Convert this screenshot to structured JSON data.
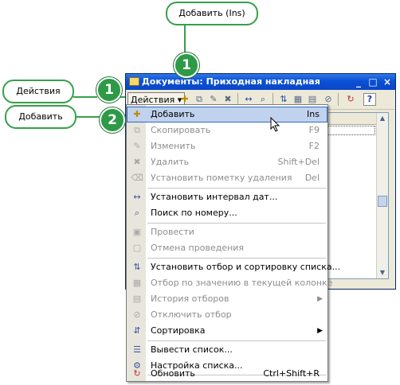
{
  "window": {
    "title": "Документы: Приходная накладная",
    "minimize_glyph": "_",
    "maximize_glyph": "□",
    "close_glyph": "×"
  },
  "toolbar": {
    "actions_label": "Действия ▾"
  },
  "callouts": {
    "add_ins": "Добавить (Ins)",
    "actions": "Действия",
    "add": "Добавить",
    "badge_top": "1",
    "badge_actions": "1",
    "badge_add": "2"
  },
  "menu": {
    "items": [
      {
        "label": "Добавить",
        "shortcut": "Ins",
        "disabled": false,
        "icon": "add-icon"
      },
      {
        "label": "Скопировать",
        "shortcut": "F9",
        "disabled": true,
        "icon": "copy-icon"
      },
      {
        "label": "Изменить",
        "shortcut": "F2",
        "disabled": true,
        "icon": "edit-icon"
      },
      {
        "label": "Удалить",
        "shortcut": "Shift+Del",
        "disabled": true,
        "icon": "delete-icon"
      },
      {
        "label": "Установить пометку удаления",
        "shortcut": "Del",
        "disabled": true,
        "icon": "mark-delete-icon"
      },
      {
        "label": "Установить интервал дат...",
        "shortcut": "",
        "disabled": false,
        "icon": "date-interval-icon"
      },
      {
        "label": "Поиск по номеру...",
        "shortcut": "",
        "disabled": false,
        "icon": "search-number-icon"
      },
      {
        "label": "Провести",
        "shortcut": "",
        "disabled": true,
        "icon": "post-icon"
      },
      {
        "label": "Отмена проведения",
        "shortcut": "",
        "disabled": true,
        "icon": "unpost-icon"
      },
      {
        "label": "Установить отбор и сортировку списка...",
        "shortcut": "",
        "disabled": false,
        "icon": "filter-sort-icon"
      },
      {
        "label": "Отбор по значению в текущей колонке",
        "shortcut": "",
        "disabled": true,
        "icon": "filter-value-icon"
      },
      {
        "label": "История отборов",
        "shortcut": "",
        "disabled": true,
        "icon": "filter-history-icon"
      },
      {
        "label": "Отключить отбор",
        "shortcut": "",
        "disabled": true,
        "icon": "filter-off-icon"
      },
      {
        "label": "Сортировка",
        "shortcut": "",
        "disabled": false,
        "icon": "sort-icon"
      },
      {
        "label": "Вывести список...",
        "shortcut": "",
        "disabled": false,
        "icon": "print-list-icon"
      },
      {
        "label": "Настройка списка...",
        "shortcut": "",
        "disabled": false,
        "icon": "list-settings-icon"
      },
      {
        "label": "Обновить",
        "shortcut": "Ctrl+Shift+R",
        "disabled": false,
        "icon": "refresh-icon"
      }
    ]
  },
  "colors": {
    "callout_green": "#37a04b",
    "badge_green": "#2e9a47",
    "titlebar_blue": "#0b50d6",
    "highlight": "#c1d2ee"
  }
}
